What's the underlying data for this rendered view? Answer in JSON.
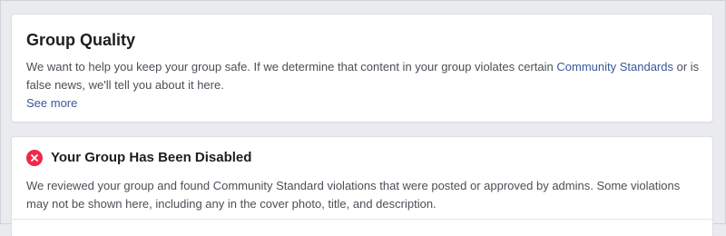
{
  "group_quality": {
    "title": "Group Quality",
    "description_before_link": "We want to help you keep your group safe. If we determine that content in your group violates certain ",
    "link_label": "Community Standards",
    "description_after_link": " or is false news, we'll tell you about it here.",
    "see_more_label": "See more"
  },
  "group_status": {
    "icon": "error-circle-icon",
    "title": "Your Group Has Been Disabled",
    "description": "We reviewed your group and found Community Standard violations that were posted or approved by admins. Some violations may not be shown here, including any in the cover photo, title, and description."
  },
  "colors": {
    "background": "#e9ebee",
    "card": "#ffffff",
    "link": "#385898",
    "error": "#f02849",
    "text_primary": "#1c1e21",
    "text_secondary": "#4b4f56"
  }
}
